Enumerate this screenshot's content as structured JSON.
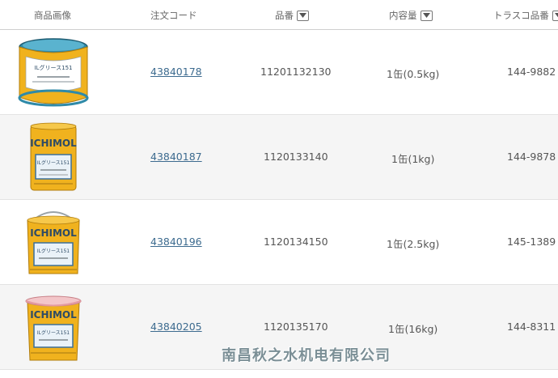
{
  "table": {
    "headers": {
      "image": "商品画像",
      "order_code": "注文コード",
      "part_no": "品番",
      "content": "内容量",
      "trusco_no": "トラスコ品番"
    },
    "rows": [
      {
        "order_code": "43840178",
        "part_no": "11201132130",
        "content": "1缶(0.5kg)",
        "trusco_no": "144-9882",
        "can_brand": "",
        "can_label": "ILグリース151"
      },
      {
        "order_code": "43840187",
        "part_no": "1120133140",
        "content": "1缶(1kg)",
        "trusco_no": "144-9878",
        "can_brand": "ICHIMOL",
        "can_label": "ILグリース151"
      },
      {
        "order_code": "43840196",
        "part_no": "1120134150",
        "content": "1缶(2.5kg)",
        "trusco_no": "145-1389",
        "can_brand": "ICHIMOL",
        "can_label": "ILグリース151"
      },
      {
        "order_code": "43840205",
        "part_no": "1120135170",
        "content": "1缶(16kg)",
        "trusco_no": "144-8311",
        "can_brand": "ICHIMOL",
        "can_label": "ILグリース151"
      }
    ]
  },
  "watermark": "南昌秋之水机电有限公司",
  "colors": {
    "link": "#3d6b8f",
    "can_yellow": "#f0b21e",
    "label_blue": "#3a6f9a",
    "row_alt": "#f5f5f5"
  },
  "icons": {
    "sort": "chevron-down-icon"
  }
}
